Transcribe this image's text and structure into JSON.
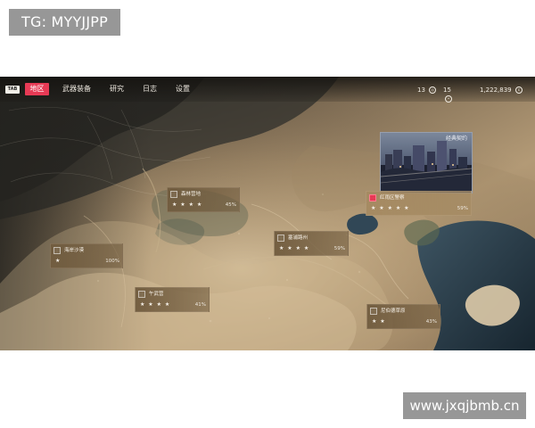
{
  "watermarks": {
    "top": "TG: MYYJJPP",
    "bottom": "www.jxqjbmb.cn"
  },
  "topbar": {
    "tab_key": "TAB",
    "nav": [
      {
        "label": "地区",
        "active": true
      },
      {
        "label": "武器装备",
        "active": false
      },
      {
        "label": "研究",
        "active": false
      },
      {
        "label": "日志",
        "active": false
      },
      {
        "label": "设置",
        "active": false
      }
    ],
    "resources": [
      {
        "value": "13",
        "icon": "intel-icon"
      },
      {
        "value": "15",
        "icon": "token-icon"
      },
      {
        "value": "1,222,839",
        "icon": "currency-icon"
      }
    ]
  },
  "preview": {
    "title": "经典契约",
    "icon": "city-night-icon"
  },
  "markers": [
    {
      "name": "森林营地",
      "stars": "★ ★ ★ ★",
      "progress": "45%",
      "selected": false
    },
    {
      "name": "红雨区警察",
      "stars": "★ ★ ★ ★ ★",
      "progress": "59%",
      "selected": true
    },
    {
      "name": "海岸沙漠",
      "stars": "★",
      "progress": "100%",
      "selected": false
    },
    {
      "name": "塞浦路州",
      "stars": "★ ★ ★ ★",
      "progress": "59%",
      "selected": false
    },
    {
      "name": "午武营",
      "stars": "★ ★ ★ ★",
      "progress": "41%",
      "selected": false
    },
    {
      "name": "尼伯德草原",
      "stars": "★ ★",
      "progress": "43%",
      "selected": false
    }
  ],
  "colors": {
    "accent": "#e73a55",
    "map_sand": "#b59a74",
    "water": "#233847"
  }
}
